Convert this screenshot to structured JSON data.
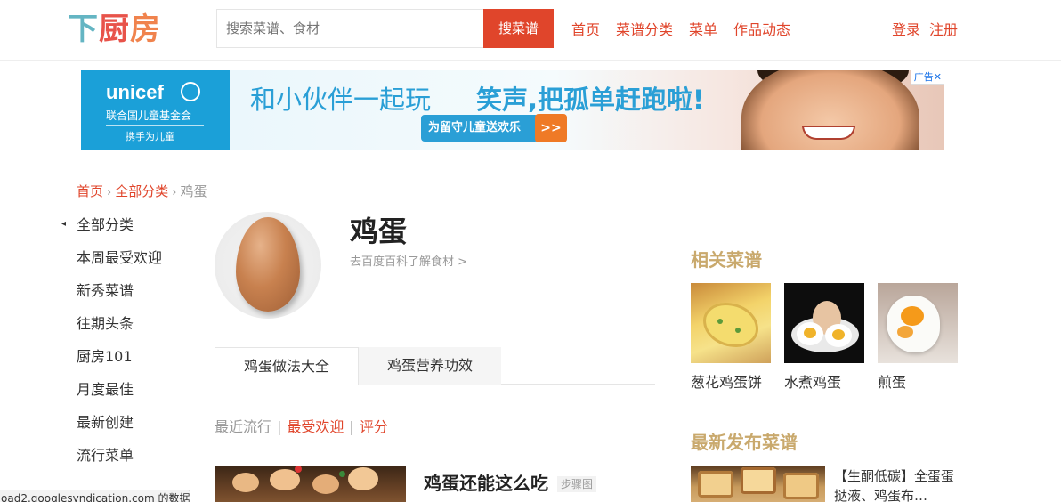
{
  "header": {
    "logo": {
      "part1": "下",
      "part2": "厨",
      "part3": "房"
    },
    "search_placeholder": "搜索菜谱、食材",
    "search_button": "搜菜谱",
    "nav": [
      "首页",
      "菜谱分类",
      "菜单",
      "作品动态"
    ],
    "login": "登录",
    "register": "注册"
  },
  "banner": {
    "brand": "unicef",
    "brand_cn": "联合国儿童基金会",
    "brand_tagline": "携手为儿童",
    "slogan1": "和小伙伴一起玩",
    "slogan2": "笑声,把孤单赶跑啦!",
    "cta": "为留守儿童送欢乐",
    "cta_arrow": ">>",
    "ad_label": "广告",
    "ad_close": "✕"
  },
  "breadcrumb": {
    "home": "首页",
    "category": "全部分类",
    "current": "鸡蛋",
    "sep": "›"
  },
  "sidebar": {
    "items": [
      "全部分类",
      "本周最受欢迎",
      "新秀菜谱",
      "往期头条",
      "厨房101",
      "月度最佳",
      "最新创建",
      "流行菜单"
    ]
  },
  "ingredient": {
    "name": "鸡蛋",
    "baike_link": "去百度百科了解食材 >"
  },
  "tabs": [
    "鸡蛋做法大全",
    "鸡蛋营养功效"
  ],
  "sort": {
    "options": [
      "最近流行",
      "最受欢迎",
      "评分"
    ],
    "separator": "|"
  },
  "recipe": {
    "title": "鸡蛋还能这么吃",
    "badge": "步骤图"
  },
  "related": {
    "heading": "相关菜谱",
    "items": [
      "葱花鸡蛋饼",
      "水煮鸡蛋",
      "煎蛋"
    ]
  },
  "latest": {
    "heading": "最新发布菜谱",
    "title": "【生酮低碳】全蛋蛋挞液、鸡蛋布…"
  },
  "status_bar": "oad2.googlesyndication.com 的数据…"
}
